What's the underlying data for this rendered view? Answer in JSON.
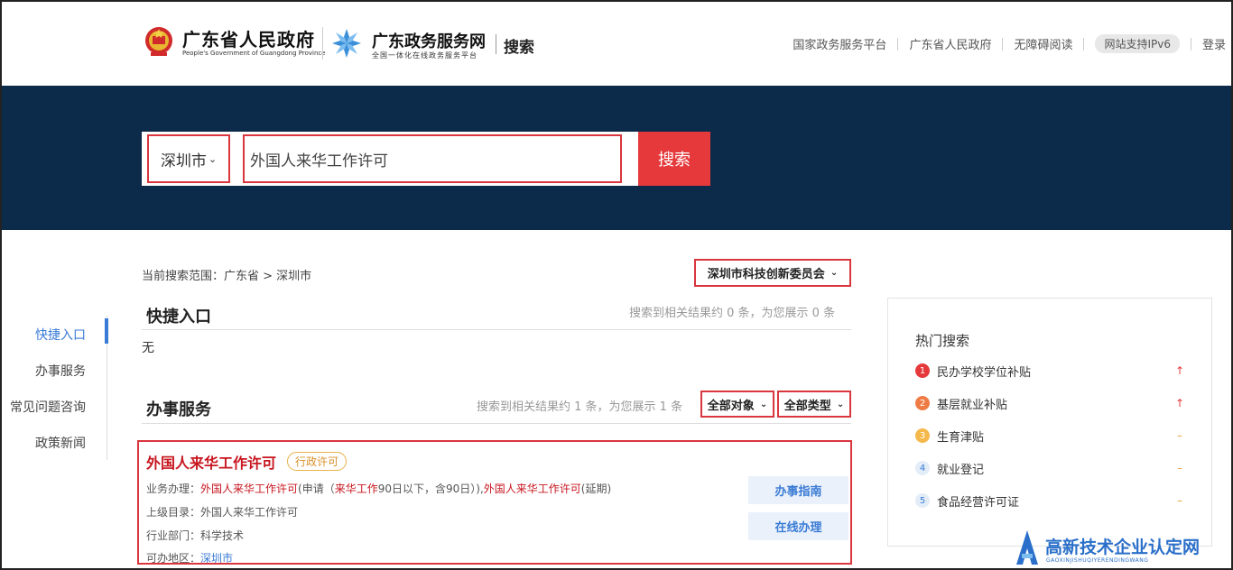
{
  "header": {
    "gov_name": "广东省人民政府",
    "gov_name_en": "People's Government of Guangdong Province",
    "service_name": "广东政务服务网",
    "service_subtitle": "全国一体化在线政务服务平台",
    "search_label": "搜索",
    "top_links": [
      "国家政务服务平台",
      "广东省人民政府",
      "无障碍阅读"
    ],
    "ipv6_badge": "网站支持IPv6",
    "login": "登录"
  },
  "search": {
    "city": "深圳市",
    "query": "外国人来华工作许可",
    "button": "搜索"
  },
  "left_nav": {
    "items": [
      "快捷入口",
      "办事服务",
      "常见问题咨询",
      "政策新闻"
    ],
    "active_index": 0
  },
  "scope": {
    "text": "当前搜索范围：广东省 > 深圳市",
    "dept_select": "深圳市科技创新委员会"
  },
  "quick_entry": {
    "title": "快捷入口",
    "note": "搜索到相关结果约 0 条，为您展示 0 条",
    "empty": "无"
  },
  "services": {
    "title": "办事服务",
    "note": "搜索到相关结果约 1 条，为您展示 1 条",
    "filter_target": "全部对象",
    "filter_type": "全部类型"
  },
  "result": {
    "title": "外国人来华工作许可",
    "tag": "行政许可",
    "business_label": "业务办理：",
    "business_item1": "外国人来华工作许可",
    "business_mid1": "(申请（",
    "business_hl2": "来华工作",
    "business_mid2": "90日以下，含90日）),",
    "business_item3": "外国人来华工作许可",
    "business_end": "(延期)",
    "parent_label": "上级目录：",
    "parent_value": "外国人来华工作许可",
    "dept_label": "行业部门：",
    "dept_value": "科学技术",
    "area_label": "可办地区：",
    "area_value": "深圳市",
    "guide_button": "办事指南",
    "online_button": "在线办理"
  },
  "hot_search": {
    "title": "热门搜索",
    "items": [
      {
        "rank": "1",
        "label": "民办学校学位补贴",
        "trend": "↑"
      },
      {
        "rank": "2",
        "label": "基层就业补贴",
        "trend": "↑"
      },
      {
        "rank": "3",
        "label": "生育津贴",
        "trend": "–"
      },
      {
        "rank": "4",
        "label": "就业登记",
        "trend": "–"
      },
      {
        "rank": "5",
        "label": "食品经营许可证",
        "trend": "–"
      }
    ],
    "rank_colors": [
      "#e5393c",
      "#f07c45",
      "#f5b84a",
      "#e3edf7",
      "#e3edf7"
    ],
    "trend_colors": [
      "#e5393c",
      "#e5393c",
      "#e8a23a",
      "#e8a23a",
      "#e8a23a"
    ]
  },
  "watermark": {
    "text": "高新技术企业认定网",
    "sub": "GAOXINJISHUQIYERENDINGWANG"
  },
  "colors": {
    "band": "#0c2a4a",
    "accent_red": "#e5393c",
    "link_blue": "#3a7bd5"
  }
}
